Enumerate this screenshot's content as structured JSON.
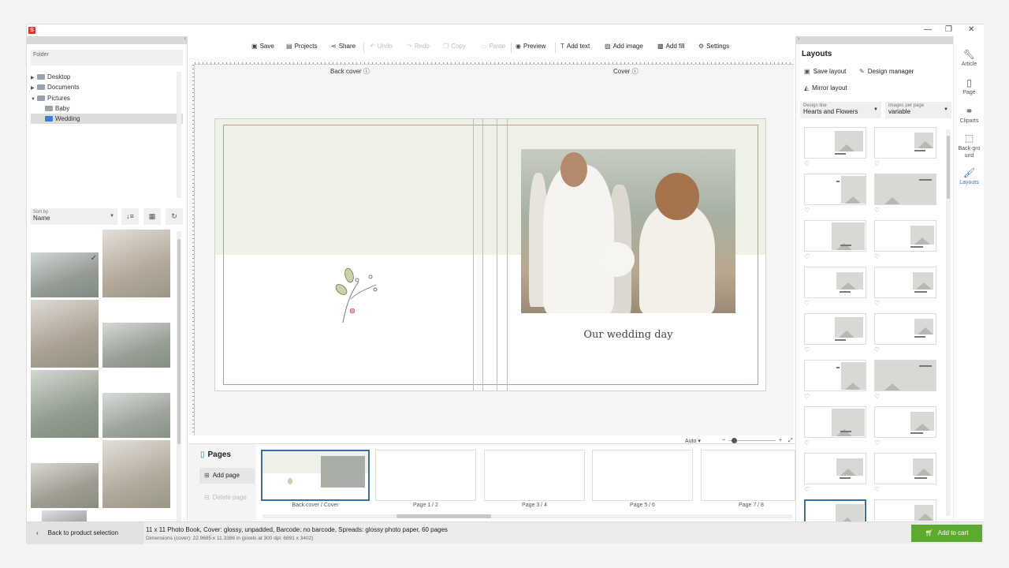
{
  "window": {
    "app_logo": "S",
    "controls": [
      "—",
      "❐",
      "✕"
    ]
  },
  "left_panel": {
    "folder_label": "Folder",
    "tree": [
      {
        "label": "Desktop",
        "toggle": "▶",
        "indent": 0
      },
      {
        "label": "Documents",
        "toggle": "▶",
        "indent": 0
      },
      {
        "label": "Pictures",
        "toggle": "▼",
        "indent": 0
      },
      {
        "label": "Baby",
        "toggle": "",
        "indent": 1
      },
      {
        "label": "Wedding",
        "toggle": "",
        "indent": 1,
        "selected": true
      }
    ],
    "sort_label": "Sort by",
    "sort_value": "Name"
  },
  "toolbar": {
    "save": "Save",
    "projects": "Projects",
    "share": "Share",
    "undo": "Undo",
    "redo": "Redo",
    "copy": "Copy",
    "paste": "Paste",
    "preview": "Preview",
    "add_text": "Add text",
    "add_image": "Add image",
    "add_fill": "Add fill",
    "settings": "Settings"
  },
  "canvas": {
    "back_cover_label": "Back cover",
    "cover_label": "Cover",
    "cover_title": "Our wedding day",
    "zoom_value": "Auto"
  },
  "pages_panel": {
    "title": "Pages",
    "add_page": "Add page",
    "delete_page": "Delete page",
    "pages": [
      "Back cover / Cover",
      "Page 1 / 2",
      "Page 3 / 4",
      "Page 5 / 6",
      "Page 7 / 8"
    ]
  },
  "right_panel": {
    "title": "Layouts",
    "save_layout": "Save layout",
    "design_manager": "Design manager",
    "mirror_layout": "Mirror layout",
    "design_line_label": "Design line",
    "design_line_value": "Hearts and Flowers",
    "images_per_page_label": "Images per page",
    "images_per_page_value": "variable"
  },
  "side_tabs": [
    {
      "label": "Article",
      "icon": "wrench-icon"
    },
    {
      "label": "Page",
      "icon": "page-icon"
    },
    {
      "label": "Cliparts",
      "icon": "cliparts-icon"
    },
    {
      "label": "Back-ground",
      "icon": "background-icon"
    },
    {
      "label": "Layouts",
      "icon": "brush-icon",
      "selected": true
    }
  ],
  "status_bar": {
    "back": "Back to product selection",
    "line1": "11 x 11 Photo Book, Cover: glossy, unpadded, Barcode: no barcode, Spreads: glossy photo paper, 60 pages",
    "line2": "Dimensions (cover): 22.9685 x 11.3386 in (pixels at 300 dpi: 6891 x 3402)",
    "cart": "Add to cart"
  },
  "colors": {
    "accent": "#3a6ea5",
    "cart_green": "#5daa2e",
    "band_green": "#eef1e6",
    "frame_red": "#c89595"
  }
}
